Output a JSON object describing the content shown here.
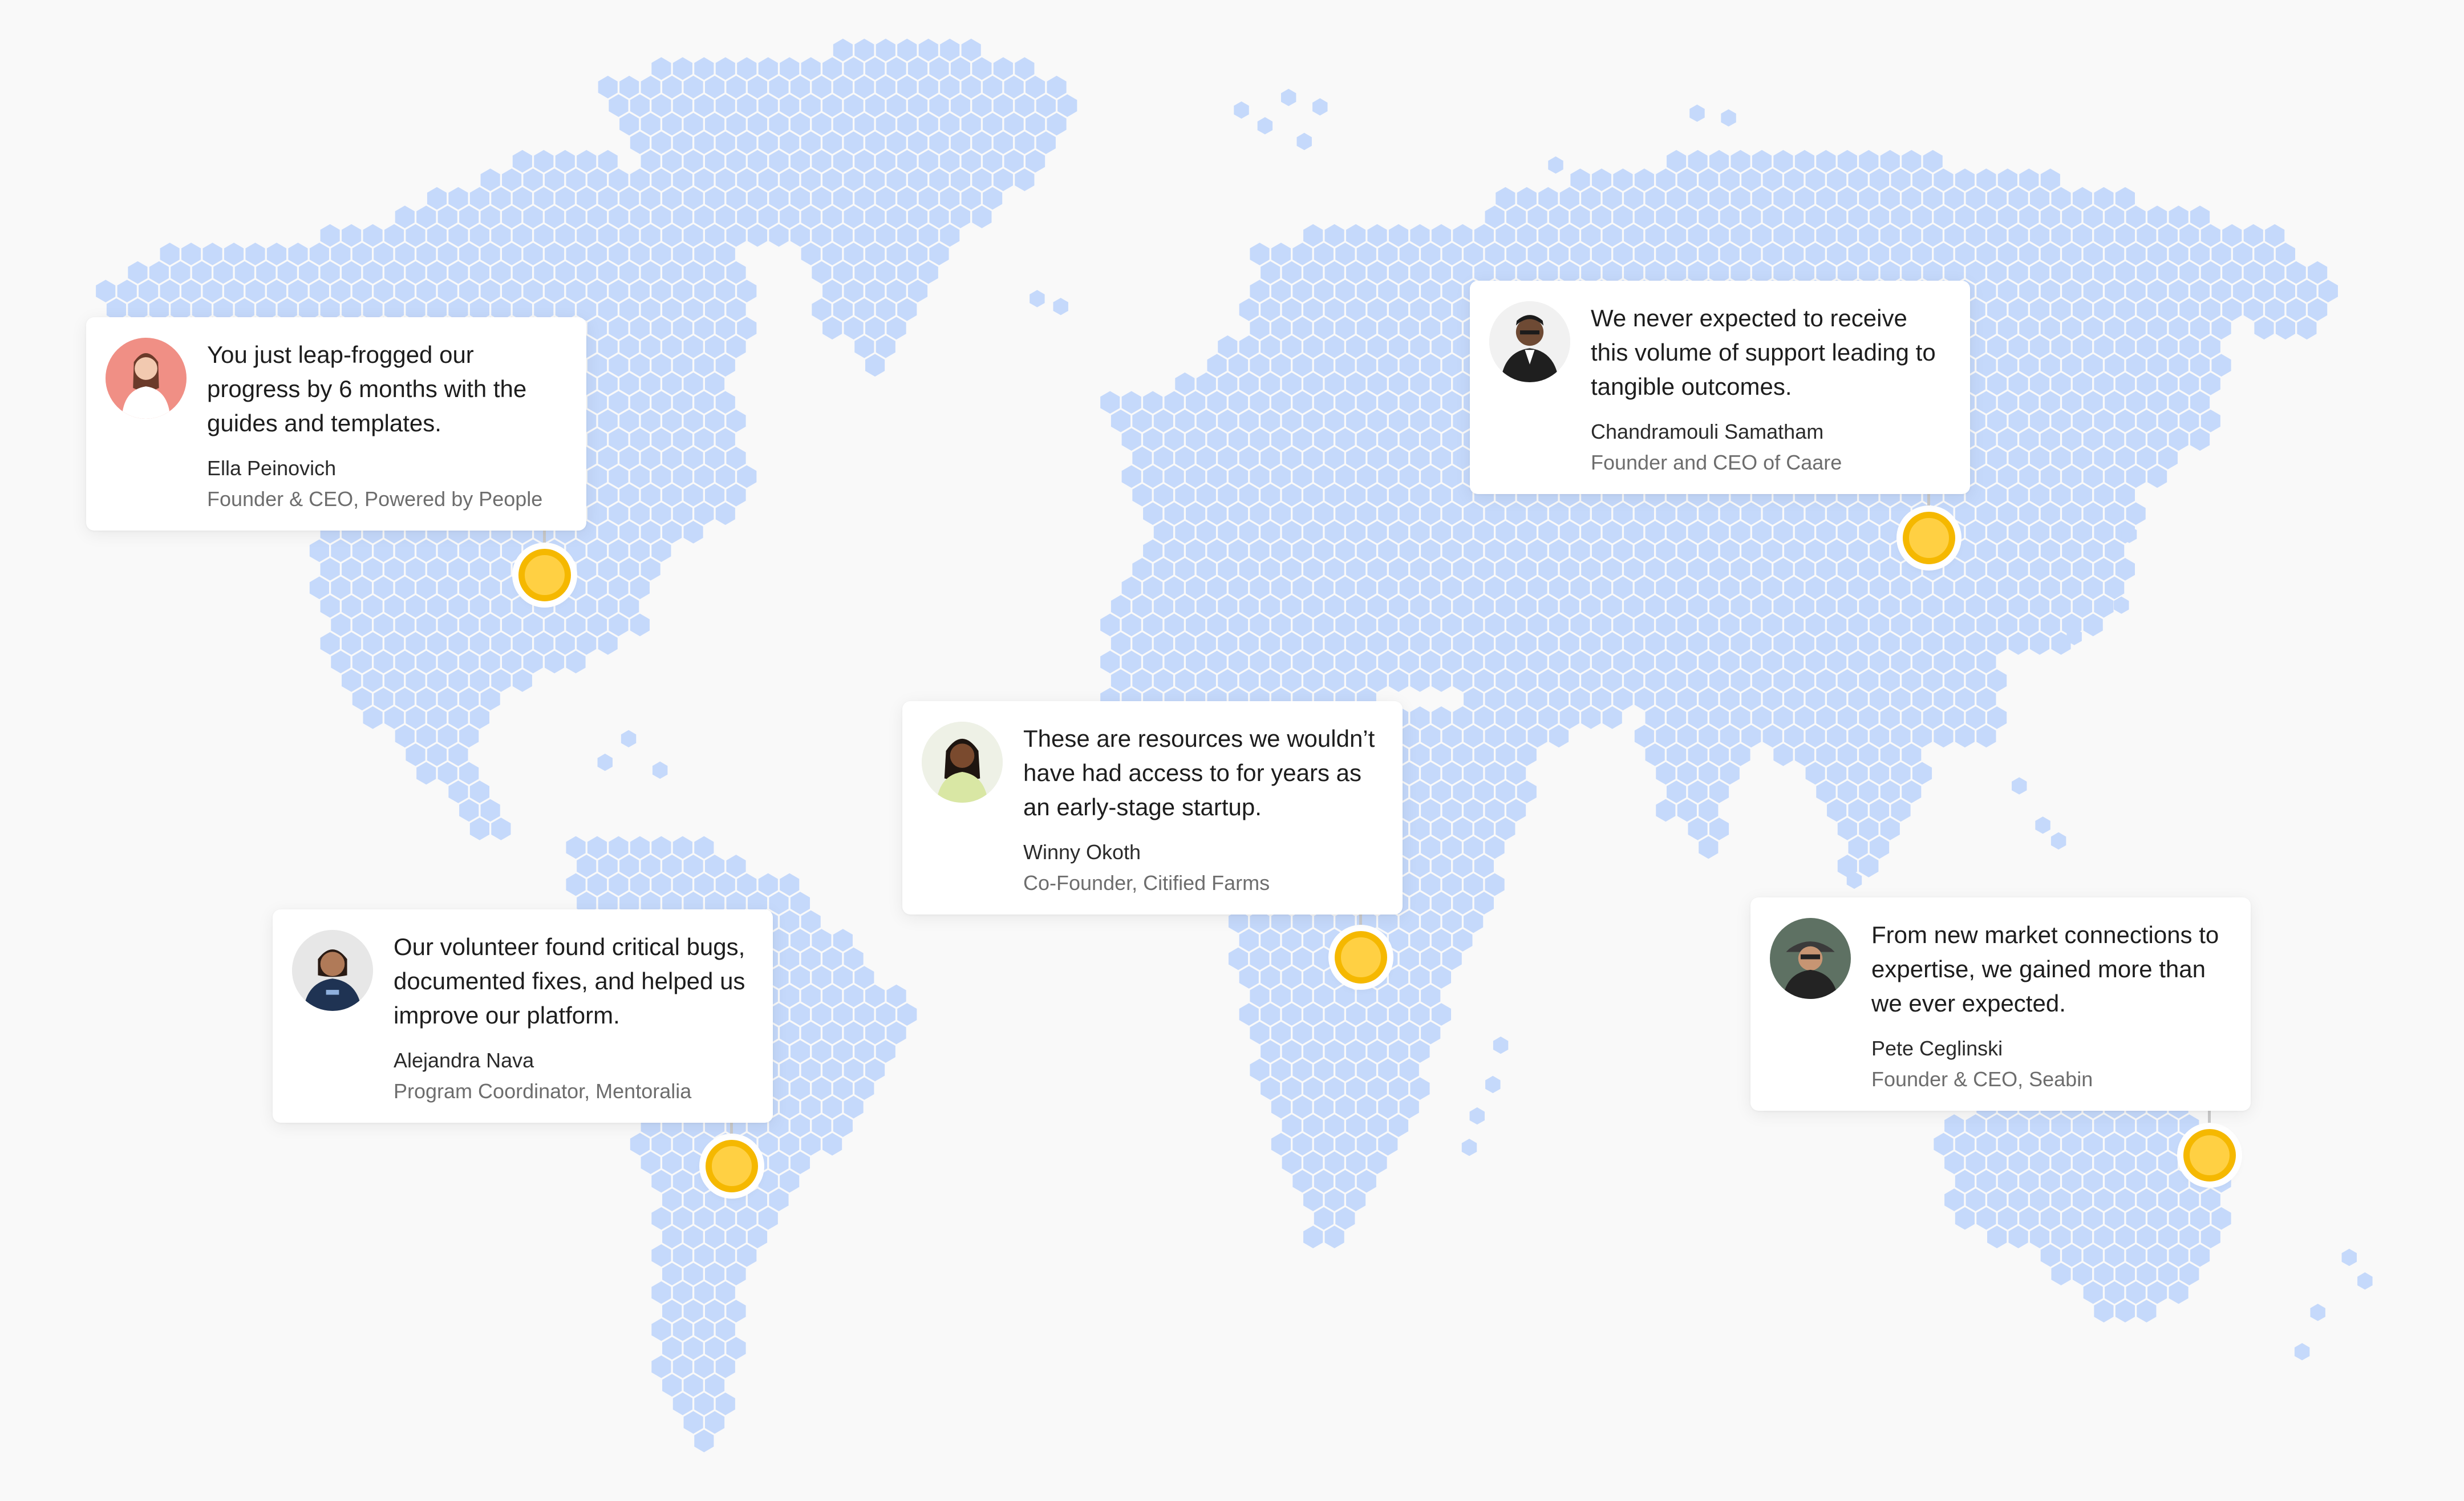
{
  "map": {
    "land_color": "#c5d9fb",
    "background_color": "#f9f9f9",
    "pin_color": "#ffd043",
    "pin_ring_color": "#f5b800"
  },
  "testimonials": [
    {
      "quote": "You just leap-frogged our progress by 6 months with the guides and templates.",
      "name": "Ella Peinovich",
      "role": "Founder & CEO, Powered by People",
      "avatar_bg": "#f08f85"
    },
    {
      "quote": "We never expected to receive this volume of support leading to tangible outcomes.",
      "name": "Chandramouli Samatham",
      "role": "Founder and CEO of Caare",
      "avatar_bg": "#f1f1f1"
    },
    {
      "quote": "These are resources we wouldn’t have had access to for years as an early-stage startup.",
      "name": "Winny Okoth",
      "role": "Co-Founder, Citified Farms",
      "avatar_bg": "#eef1e6"
    },
    {
      "quote": "Our volunteer found critical bugs, documented fixes, and helped us improve our platform.",
      "name": "Alejandra Nava",
      "role": "Program Coordinator, Mentoralia",
      "avatar_bg": "#e7e7e7"
    },
    {
      "quote": "From new market connections to expertise, we gained more than we ever expected.",
      "name": "Pete Ceglinski",
      "role": "Founder & CEO, Seabin",
      "avatar_bg": "#5e7163"
    }
  ]
}
